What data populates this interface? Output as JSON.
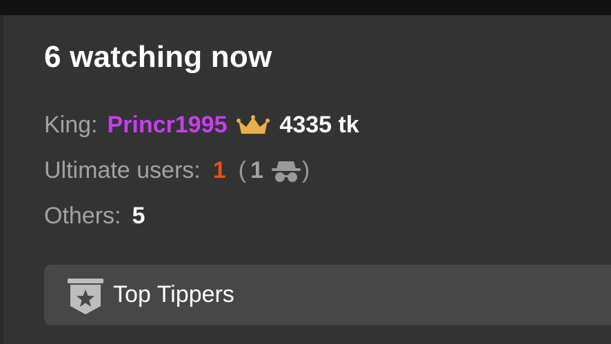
{
  "header": {
    "title": "6 watching now"
  },
  "king": {
    "label": "King:",
    "name": "Princr1995",
    "tokens": "4335 tk",
    "crown_color": "#e8b04a",
    "name_color": "#c73ff0"
  },
  "ultimate": {
    "label": "Ultimate users:",
    "count": "1",
    "paren_open": "(",
    "anonymous_count": "1",
    "paren_close": ")",
    "count_color": "#e8511f",
    "icon": "anonymous-spy-icon"
  },
  "others": {
    "label": "Others:",
    "count": "5"
  },
  "top_tippers": {
    "label": "Top Tippers",
    "icon": "star-badge-icon"
  }
}
